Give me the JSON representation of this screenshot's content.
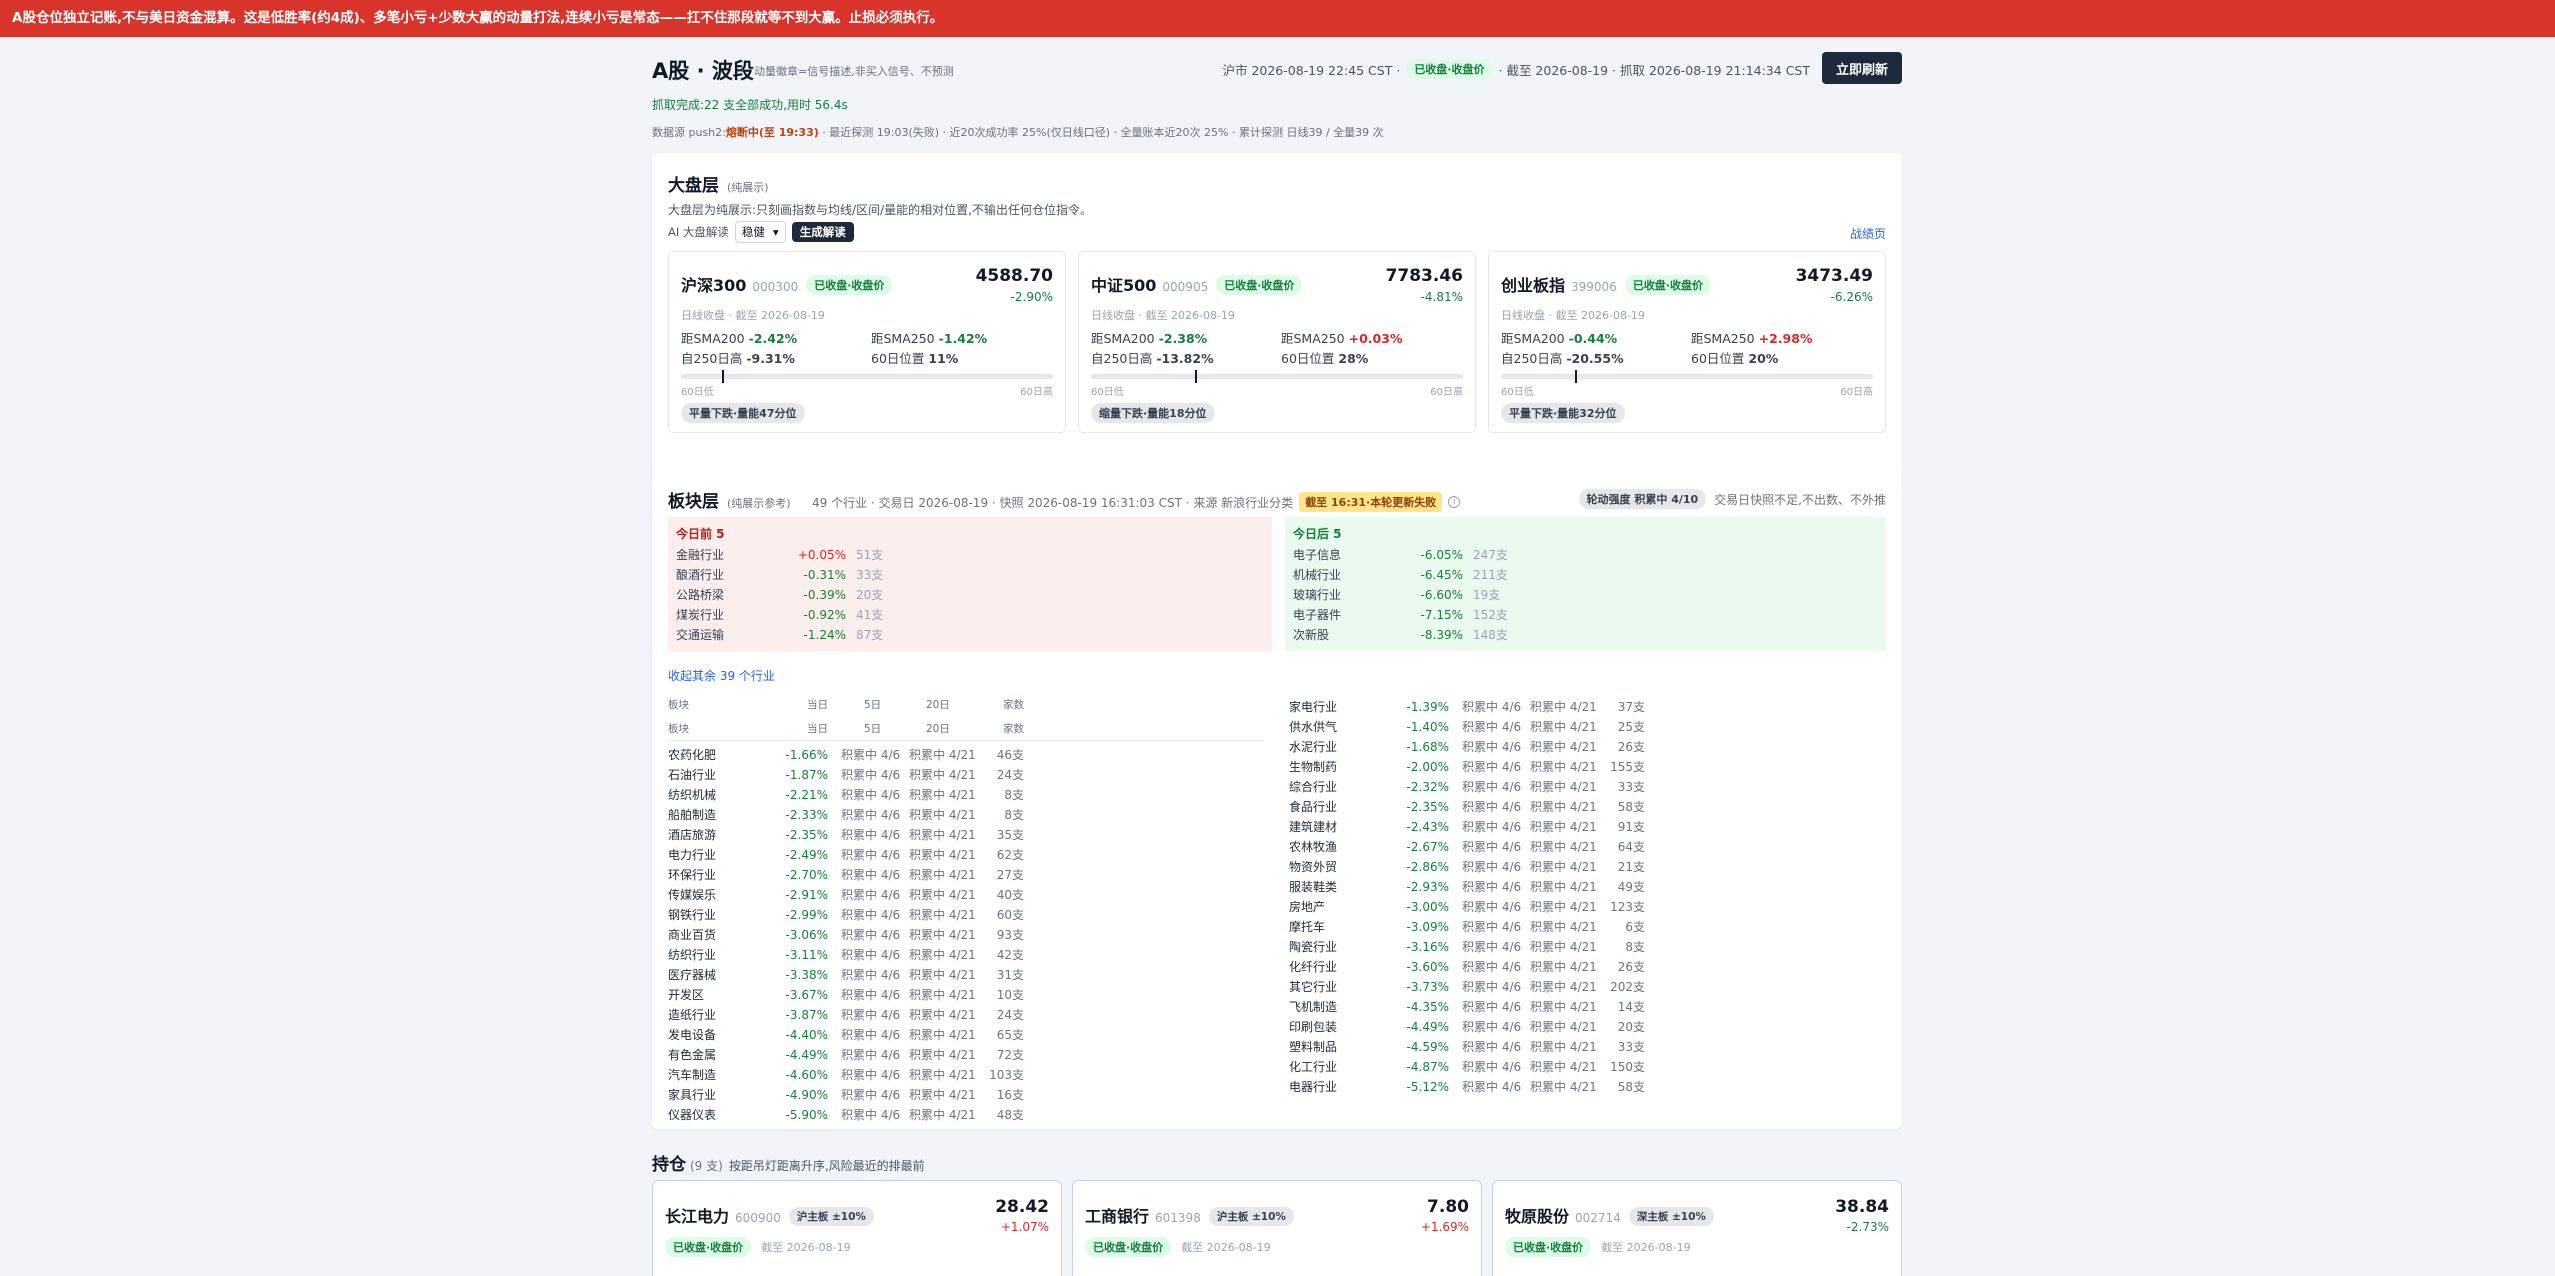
{
  "banner": "A股仓位独立记账,不与美日资金混算。这是低胜率(约4成)、多笔小亏+少数大赢的动量打法,连续小亏是常态——扛不住那段就等不到大赢。止损必须执行。",
  "header": {
    "title": "A股 · 波段",
    "subtitle": "动量徽章=信号描述,非买入信号、不预测",
    "clock": "沪市 2026-08-19 22:45 CST ·",
    "clock_tag": "已收盘·收盘价",
    "asof": "· 截至 2026-08-19 · 抓取 2026-08-19 21:14:34 CST",
    "refresh_label": "立即刷新"
  },
  "status_line": "抓取完成:22 支全部成功,用时 56.4s",
  "source_line": {
    "prefix": "数据源 push2:",
    "warn": "熔断中(至 19:33)",
    "rest": " · 最近探测 19:03(失败) · 近20次成功率 25%(仅日线口径) · 全量账本近20次 25% · 累计探测 日线39 / 全量39 次"
  },
  "market": {
    "title": "大盘层",
    "title_note": "(纯展示)",
    "desc": "大盘层为纯展示:只刻画指数与均线/区间/量能的相对位置,不输出任何仓位指令。",
    "ai_label": "AI 大盘解读",
    "ai_select": "稳健",
    "ai_button": "生成解读",
    "link": "战绩页",
    "indices": [
      {
        "name": "沪深300",
        "code": "000300",
        "tag": "已收盘·收盘价",
        "price": "4588.70",
        "pct": "-2.90%",
        "line": "日线收盘 · 截至 2026-08-19",
        "sma200_label": "距SMA200",
        "sma200": "-2.42%",
        "sma200_sign": "neg",
        "sma250_label": "距SMA250",
        "sma250": "-1.42%",
        "sma250_sign": "neg",
        "high250_label": "自250日高",
        "high250": "-9.31%",
        "pos60_label": "60日位置",
        "pos60": "11%",
        "pos60_value": 0.11,
        "lo": "60日低",
        "hi": "60日高",
        "badge": "平量下跌·量能47分位"
      },
      {
        "name": "中证500",
        "code": "000905",
        "tag": "已收盘·收盘价",
        "price": "7783.46",
        "pct": "-4.81%",
        "line": "日线收盘 · 截至 2026-08-19",
        "sma200_label": "距SMA200",
        "sma200": "-2.38%",
        "sma200_sign": "neg",
        "sma250_label": "距SMA250",
        "sma250": "+0.03%",
        "sma250_sign": "pos",
        "high250_label": "自250日高",
        "high250": "-13.82%",
        "pos60_label": "60日位置",
        "pos60": "28%",
        "pos60_value": 0.28,
        "lo": "60日低",
        "hi": "60日高",
        "badge": "缩量下跌·量能18分位"
      },
      {
        "name": "创业板指",
        "code": "399006",
        "tag": "已收盘·收盘价",
        "price": "3473.49",
        "pct": "-6.26%",
        "line": "日线收盘 · 截至 2026-08-19",
        "sma200_label": "距SMA200",
        "sma200": "-0.44%",
        "sma200_sign": "neg",
        "sma250_label": "距SMA250",
        "sma250": "+2.98%",
        "sma250_sign": "pos",
        "high250_label": "自250日高",
        "high250": "-20.55%",
        "pos60_label": "60日位置",
        "pos60": "20%",
        "pos60_value": 0.2,
        "lo": "60日低",
        "hi": "60日高",
        "badge": "平量下跌·量能32分位"
      }
    ]
  },
  "sector": {
    "title": "板块层",
    "title_note": "(纯展示参考)",
    "meta": "49 个行业 · 交易日 2026-08-19 · 快照 2026-08-19 16:31:03 CST · 来源 新浪行业分类",
    "stale_tag": "截至 16:31·本轮更新失败",
    "info_icon": "i",
    "rot_tag": "轮动强度 积累中 4/10",
    "rot_note": "交易日快照不足,不出数、不外推",
    "top_title": "今日前 5",
    "top": [
      {
        "name": "金融行业",
        "pct": "+0.05%",
        "sign": "pos",
        "count": "51支"
      },
      {
        "name": "酿酒行业",
        "pct": "-0.31%",
        "sign": "neg",
        "count": "33支"
      },
      {
        "name": "公路桥梁",
        "pct": "-0.39%",
        "sign": "neg",
        "count": "20支"
      },
      {
        "name": "煤炭行业",
        "pct": "-0.92%",
        "sign": "neg",
        "count": "41支"
      },
      {
        "name": "交通运输",
        "pct": "-1.24%",
        "sign": "neg",
        "count": "87支"
      }
    ],
    "bottom_title": "今日后 5",
    "bottom": [
      {
        "name": "电子信息",
        "pct": "-6.05%",
        "sign": "neg",
        "count": "247支"
      },
      {
        "name": "机械行业",
        "pct": "-6.45%",
        "sign": "neg",
        "count": "211支"
      },
      {
        "name": "玻璃行业",
        "pct": "-6.60%",
        "sign": "neg",
        "count": "19支"
      },
      {
        "name": "电子器件",
        "pct": "-7.15%",
        "sign": "neg",
        "count": "152支"
      },
      {
        "name": "次新股",
        "pct": "-8.39%",
        "sign": "neg",
        "count": "148支"
      }
    ],
    "collapse_link": "收起其余 39 个行业",
    "headers": {
      "name": "板块",
      "day": "当日",
      "d5": "5日",
      "d20": "20日",
      "count": "家数"
    },
    "left_rows": [
      [
        "农药化肥",
        "-1.66%",
        "积累中 4/6",
        "积累中 4/21",
        "46支"
      ],
      [
        "石油行业",
        "-1.87%",
        "积累中 4/6",
        "积累中 4/21",
        "24支"
      ],
      [
        "纺织机械",
        "-2.21%",
        "积累中 4/6",
        "积累中 4/21",
        "8支"
      ],
      [
        "船舶制造",
        "-2.33%",
        "积累中 4/6",
        "积累中 4/21",
        "8支"
      ],
      [
        "酒店旅游",
        "-2.35%",
        "积累中 4/6",
        "积累中 4/21",
        "35支"
      ],
      [
        "电力行业",
        "-2.49%",
        "积累中 4/6",
        "积累中 4/21",
        "62支"
      ],
      [
        "环保行业",
        "-2.70%",
        "积累中 4/6",
        "积累中 4/21",
        "27支"
      ],
      [
        "传媒娱乐",
        "-2.91%",
        "积累中 4/6",
        "积累中 4/21",
        "40支"
      ],
      [
        "钢铁行业",
        "-2.99%",
        "积累中 4/6",
        "积累中 4/21",
        "60支"
      ],
      [
        "商业百货",
        "-3.06%",
        "积累中 4/6",
        "积累中 4/21",
        "93支"
      ],
      [
        "纺织行业",
        "-3.11%",
        "积累中 4/6",
        "积累中 4/21",
        "42支"
      ],
      [
        "医疗器械",
        "-3.38%",
        "积累中 4/6",
        "积累中 4/21",
        "31支"
      ],
      [
        "开发区",
        "-3.67%",
        "积累中 4/6",
        "积累中 4/21",
        "10支"
      ],
      [
        "造纸行业",
        "-3.87%",
        "积累中 4/6",
        "积累中 4/21",
        "24支"
      ],
      [
        "发电设备",
        "-4.40%",
        "积累中 4/6",
        "积累中 4/21",
        "65支"
      ],
      [
        "有色金属",
        "-4.49%",
        "积累中 4/6",
        "积累中 4/21",
        "72支"
      ],
      [
        "汽车制造",
        "-4.60%",
        "积累中 4/6",
        "积累中 4/21",
        "103支"
      ],
      [
        "家具行业",
        "-4.90%",
        "积累中 4/6",
        "积累中 4/21",
        "16支"
      ],
      [
        "仪器仪表",
        "-5.90%",
        "积累中 4/6",
        "积累中 4/21",
        "48支"
      ]
    ],
    "right_rows": [
      [
        "家电行业",
        "-1.39%",
        "积累中 4/6",
        "积累中 4/21",
        "37支"
      ],
      [
        "供水供气",
        "-1.40%",
        "积累中 4/6",
        "积累中 4/21",
        "25支"
      ],
      [
        "水泥行业",
        "-1.68%",
        "积累中 4/6",
        "积累中 4/21",
        "26支"
      ],
      [
        "生物制药",
        "-2.00%",
        "积累中 4/6",
        "积累中 4/21",
        "155支"
      ],
      [
        "综合行业",
        "-2.32%",
        "积累中 4/6",
        "积累中 4/21",
        "33支"
      ],
      [
        "食品行业",
        "-2.35%",
        "积累中 4/6",
        "积累中 4/21",
        "58支"
      ],
      [
        "建筑建材",
        "-2.43%",
        "积累中 4/6",
        "积累中 4/21",
        "91支"
      ],
      [
        "农林牧渔",
        "-2.67%",
        "积累中 4/6",
        "积累中 4/21",
        "64支"
      ],
      [
        "物资外贸",
        "-2.86%",
        "积累中 4/6",
        "积累中 4/21",
        "21支"
      ],
      [
        "服装鞋类",
        "-2.93%",
        "积累中 4/6",
        "积累中 4/21",
        "49支"
      ],
      [
        "房地产",
        "-3.00%",
        "积累中 4/6",
        "积累中 4/21",
        "123支"
      ],
      [
        "摩托车",
        "-3.09%",
        "积累中 4/6",
        "积累中 4/21",
        "6支"
      ],
      [
        "陶瓷行业",
        "-3.16%",
        "积累中 4/6",
        "积累中 4/21",
        "8支"
      ],
      [
        "化纤行业",
        "-3.60%",
        "积累中 4/6",
        "积累中 4/21",
        "26支"
      ],
      [
        "其它行业",
        "-3.73%",
        "积累中 4/6",
        "积累中 4/21",
        "202支"
      ],
      [
        "飞机制造",
        "-4.35%",
        "积累中 4/6",
        "积累中 4/21",
        "14支"
      ],
      [
        "印刷包装",
        "-4.49%",
        "积累中 4/6",
        "积累中 4/21",
        "20支"
      ],
      [
        "塑料制品",
        "-4.59%",
        "积累中 4/6",
        "积累中 4/21",
        "33支"
      ],
      [
        "化工行业",
        "-4.87%",
        "积累中 4/6",
        "积累中 4/21",
        "150支"
      ],
      [
        "电器行业",
        "-5.12%",
        "积累中 4/6",
        "积累中 4/21",
        "58支"
      ]
    ]
  },
  "holdings": {
    "title": "持仓",
    "count": "(9 支)",
    "note": "按距吊灯距离升序,风险最近的排最前",
    "cards": [
      {
        "name": "长江电力",
        "code": "600900",
        "board": "沪主板 ±10%",
        "price": "28.42",
        "chg": "+1.07%",
        "sign": "pos",
        "tag": "已收盘·收盘价",
        "date": "截至 2026-08-19"
      },
      {
        "name": "工商银行",
        "code": "601398",
        "board": "沪主板 ±10%",
        "price": "7.80",
        "chg": "+1.69%",
        "sign": "pos",
        "tag": "已收盘·收盘价",
        "date": "截至 2026-08-19"
      },
      {
        "name": "牧原股份",
        "code": "002714",
        "board": "深主板 ±10%",
        "price": "38.84",
        "chg": "-2.73%",
        "sign": "neg",
        "tag": "已收盘·收盘价",
        "date": "截至 2026-08-19"
      }
    ]
  }
}
